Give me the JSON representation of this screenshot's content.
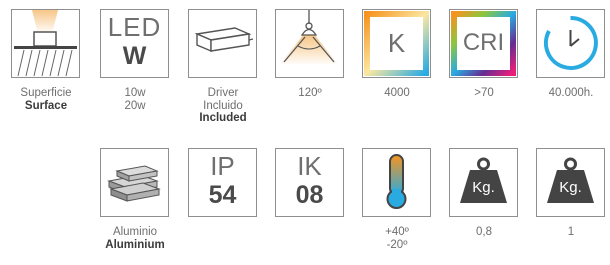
{
  "row1": [
    {
      "id": "surface",
      "caption1": "Superficie",
      "caption2": "Surface",
      "icon": "surface-mount-icon"
    },
    {
      "id": "led",
      "tile_top": "LED",
      "tile_bottom": "W",
      "caption1": "10w",
      "caption2": "20w"
    },
    {
      "id": "driver",
      "caption1": "Driver",
      "caption2": "Incluido",
      "caption3": "Included",
      "icon": "driver-box-icon"
    },
    {
      "id": "beam",
      "caption1": "120º",
      "icon": "beam-angle-lamp-icon"
    },
    {
      "id": "kelvin",
      "tile_text": "K",
      "caption1": "4000"
    },
    {
      "id": "cri",
      "tile_text": "CRI",
      "caption1": ">70"
    },
    {
      "id": "lifetime",
      "caption1": "40.000h.",
      "icon": "clock-icon"
    }
  ],
  "row2": [
    {
      "id": "aluminium",
      "caption1": "Aluminio",
      "caption2": "Aluminium",
      "icon": "aluminium-ingots-icon"
    },
    {
      "id": "ip",
      "tile_top": "IP",
      "tile_bottom": "54"
    },
    {
      "id": "ik",
      "tile_top": "IK",
      "tile_bottom": "08"
    },
    {
      "id": "temperature",
      "caption1": "+40º",
      "caption2": "-20º",
      "icon": "thermometer-icon"
    },
    {
      "id": "weight1",
      "tile_text": "Kg.",
      "caption1": "0,8"
    },
    {
      "id": "weight2",
      "tile_text": "Kg.",
      "caption1": "1"
    }
  ],
  "colors": {
    "border": "#8f8f8f",
    "clock": "#29abe2",
    "weight": "#444444",
    "thermo_hot": "#f7941d",
    "thermo_cold": "#29abe2"
  }
}
